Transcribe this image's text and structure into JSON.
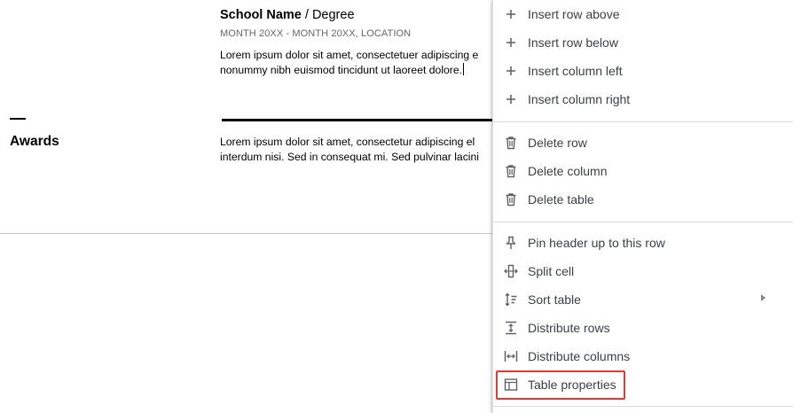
{
  "document": {
    "education": {
      "school_name": "School Name",
      "degree": " / Degree",
      "dates": "MONTH 20XX - MONTH 20XX,  LOCATION",
      "paragraph_line1": "Lorem ipsum dolor sit amet, consectetuer adipiscing e",
      "paragraph_line2": "nonummy nibh euismod tincidunt ut laoreet dolore."
    },
    "awards": {
      "title": "Awards",
      "paragraph_line1": "Lorem ipsum dolor sit amet, consectetur adipiscing el",
      "paragraph_line2": "interdum nisi. Sed in consequat mi. Sed pulvinar lacini"
    }
  },
  "context_menu": {
    "items": [
      {
        "id": "insert-row-above",
        "label": "Insert row above",
        "icon": "plus-icon"
      },
      {
        "id": "insert-row-below",
        "label": "Insert row below",
        "icon": "plus-icon"
      },
      {
        "id": "insert-column-left",
        "label": "Insert column left",
        "icon": "plus-icon"
      },
      {
        "id": "insert-column-right",
        "label": "Insert column right",
        "icon": "plus-icon"
      },
      {
        "id": "delete-row",
        "label": "Delete row",
        "icon": "trash-icon"
      },
      {
        "id": "delete-column",
        "label": "Delete column",
        "icon": "trash-icon"
      },
      {
        "id": "delete-table",
        "label": "Delete table",
        "icon": "trash-icon"
      },
      {
        "id": "pin-header",
        "label": "Pin header up to this row",
        "icon": "pin-icon"
      },
      {
        "id": "split-cell",
        "label": "Split cell",
        "icon": "split-cell-icon"
      },
      {
        "id": "sort-table",
        "label": "Sort table",
        "icon": "sort-icon",
        "has_submenu": true
      },
      {
        "id": "distribute-rows",
        "label": "Distribute rows",
        "icon": "distribute-rows-icon"
      },
      {
        "id": "distribute-columns",
        "label": "Distribute columns",
        "icon": "distribute-columns-icon"
      },
      {
        "id": "table-properties",
        "label": "Table properties",
        "icon": "table-icon",
        "highlighted": true
      }
    ],
    "highlight_color": "#e53935",
    "icon_color": "#5f6368"
  }
}
